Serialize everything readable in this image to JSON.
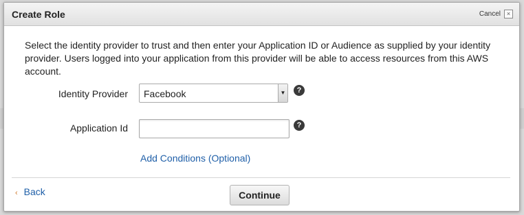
{
  "dialog": {
    "title": "Create Role",
    "cancel_label": "Cancel",
    "close_glyph": "×"
  },
  "description": "Select the identity provider to trust and then enter your Application ID or Audience as supplied by your identity provider. Users logged into your application from this provider will be able to access resources from this AWS account.",
  "form": {
    "identity_provider": {
      "label": "Identity Provider",
      "selected": "Facebook",
      "arrow_glyph": "▼",
      "help_glyph": "?"
    },
    "application_id": {
      "label": "Application Id",
      "value": "",
      "help_glyph": "?"
    },
    "add_conditions_label": "Add Conditions (Optional)"
  },
  "footer": {
    "back_chevron": "‹",
    "back_label": "Back",
    "continue_label": "Continue"
  },
  "colors": {
    "link": "#1f5fa8",
    "back_chevron": "#d0782a"
  }
}
